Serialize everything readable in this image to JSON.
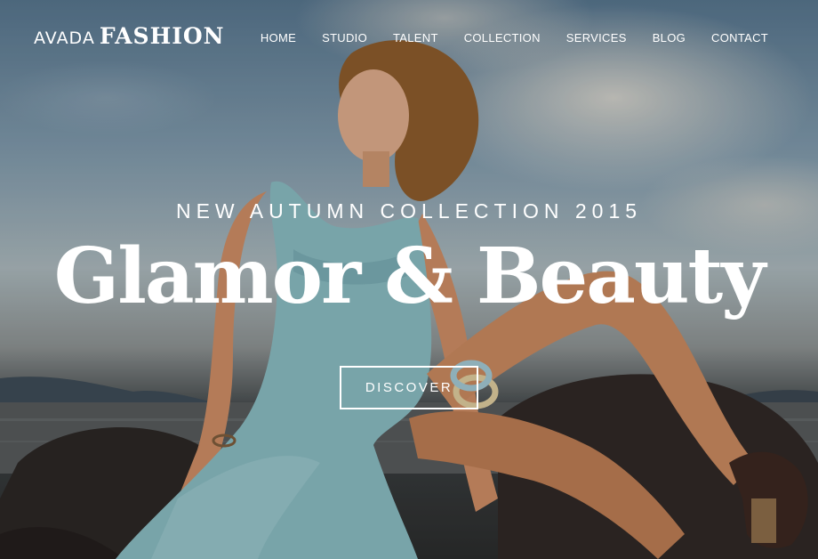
{
  "brand": {
    "light": "AVADA",
    "bold": "FASHION"
  },
  "nav": [
    {
      "label": "HOME"
    },
    {
      "label": "STUDIO"
    },
    {
      "label": "TALENT"
    },
    {
      "label": "COLLECTION"
    },
    {
      "label": "SERVICES"
    },
    {
      "label": "BLOG"
    },
    {
      "label": "CONTACT"
    }
  ],
  "hero": {
    "subtitle": "NEW AUTUMN COLLECTION 2015",
    "headline": "Glamor & Beauty",
    "cta_label": "DISCOVER"
  },
  "colors": {
    "text": "#ffffff",
    "dress": "#86b7bd",
    "sky": "#55738b"
  }
}
